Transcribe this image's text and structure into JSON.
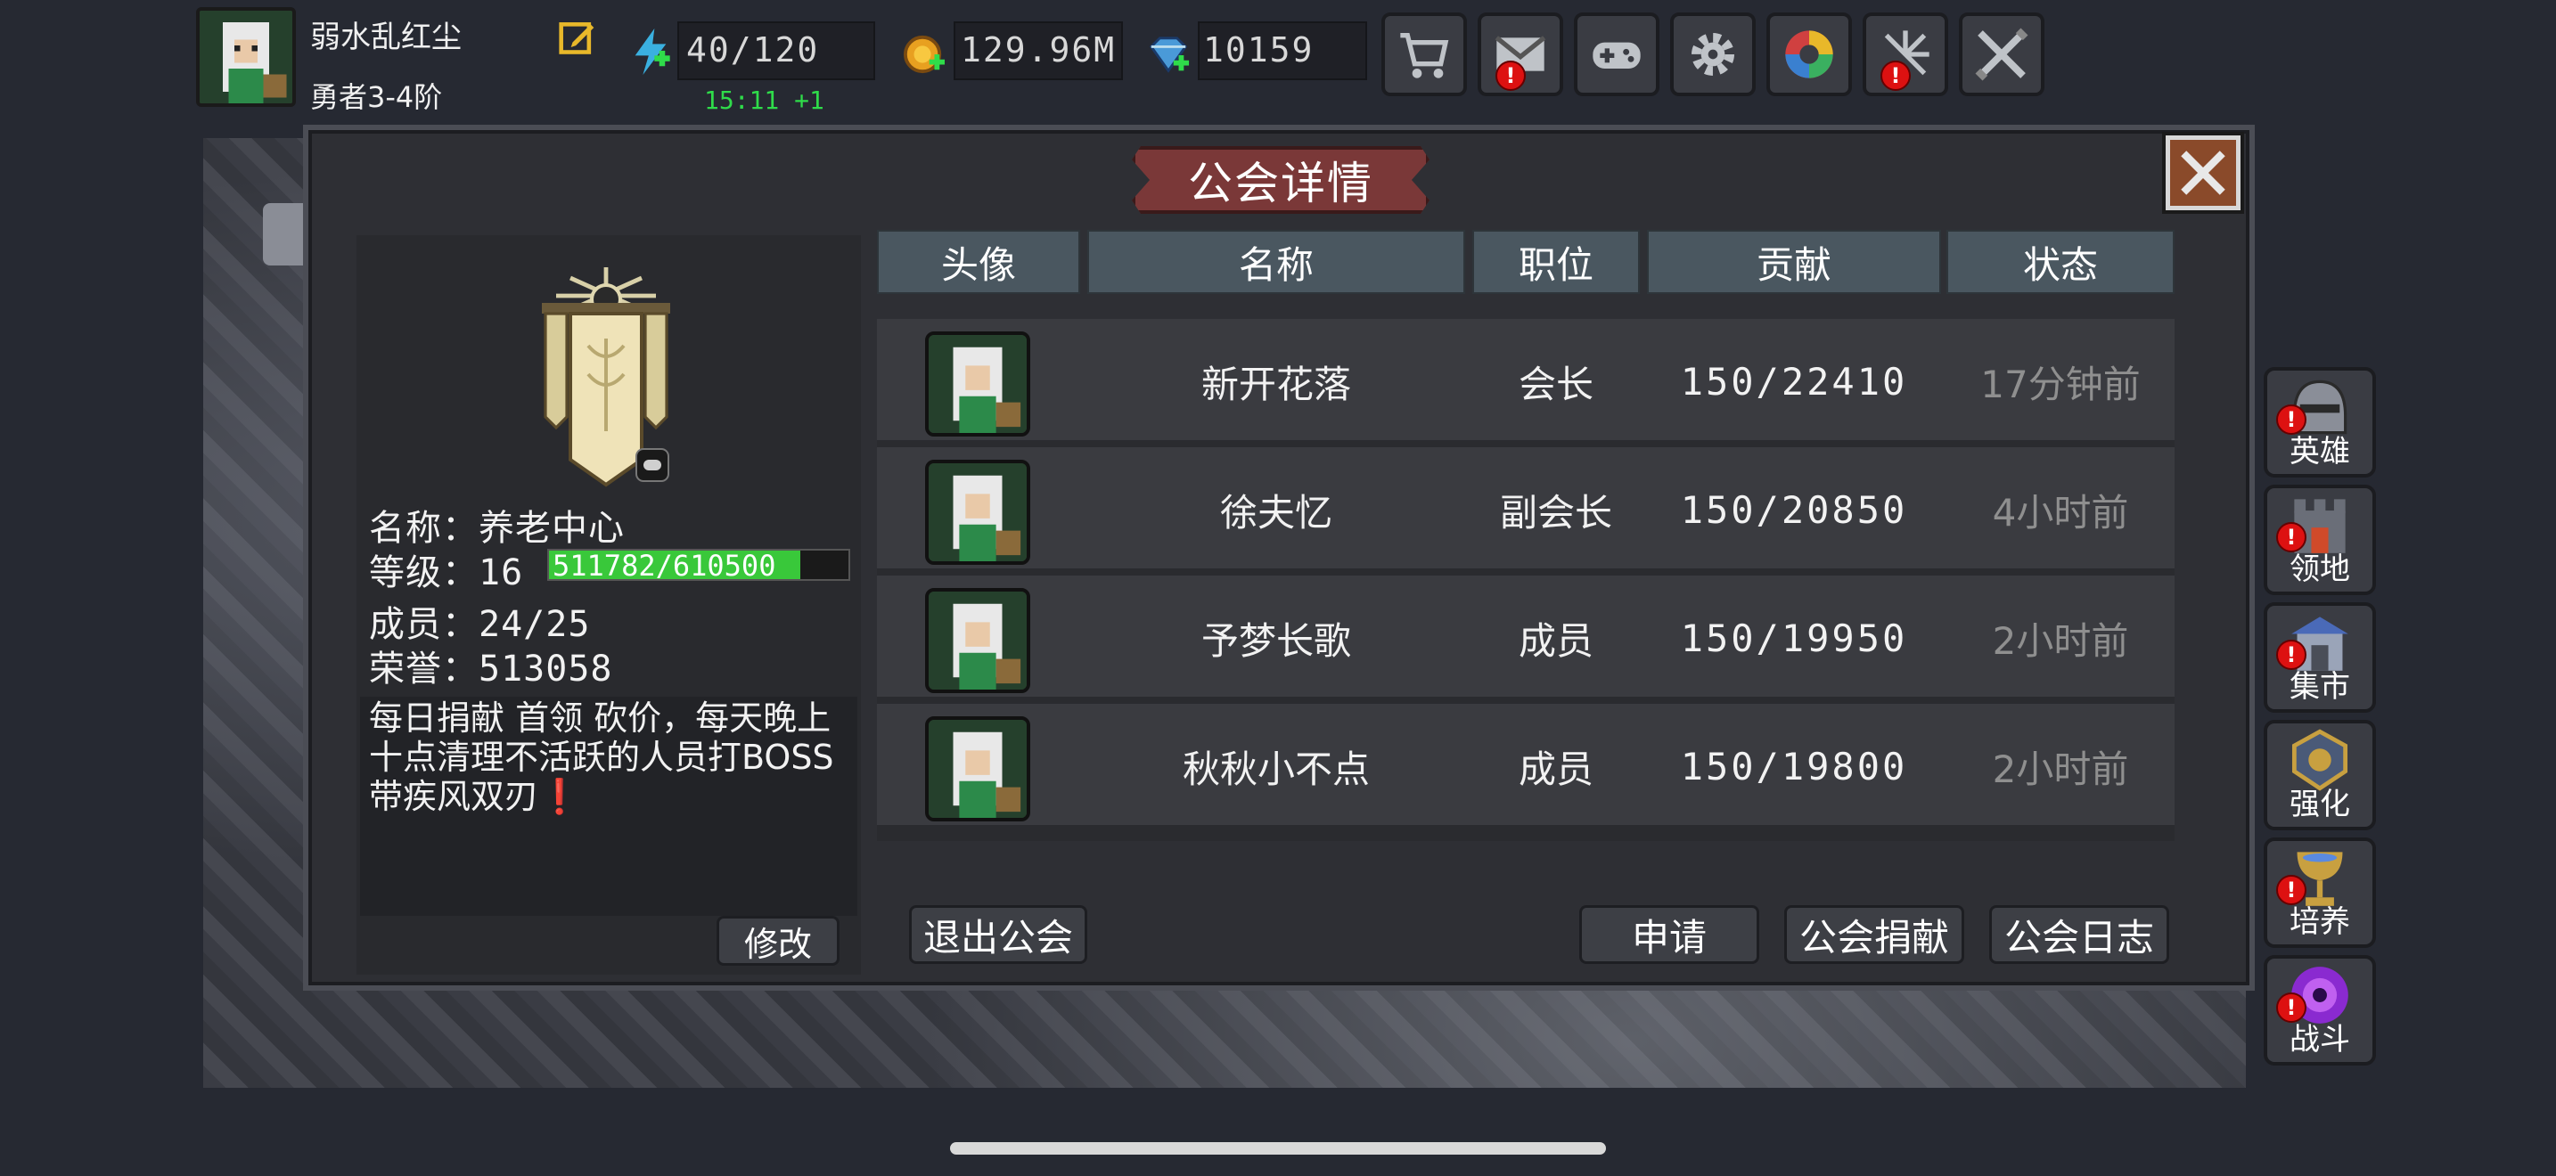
{
  "player": {
    "name": "弱水乱红尘",
    "rank": "勇者3-4阶"
  },
  "resources": {
    "energy": "40/120",
    "energy_timer": "15:11 +1",
    "gold": "129.96M",
    "gems": "10159"
  },
  "top_buttons": [
    {
      "icon": "cart-icon",
      "alert": false
    },
    {
      "icon": "mail-icon",
      "alert": true
    },
    {
      "icon": "gamepad-icon",
      "alert": false
    },
    {
      "icon": "gear-icon",
      "alert": false
    },
    {
      "icon": "aperture-icon",
      "alert": false
    },
    {
      "icon": "burst-icon",
      "alert": true
    },
    {
      "icon": "crossed-swords-icon",
      "alert": false
    }
  ],
  "dialog": {
    "title": "公会详情"
  },
  "guild": {
    "name_label": "名称：",
    "name": "养老中心",
    "level_label": "等级：",
    "level": "16",
    "xp_text": "511782/610500",
    "xp_fraction": 0.838,
    "members_label": "成员：",
    "members": "24/25",
    "honor_label": "荣誉：",
    "honor": "513058",
    "notice": "每日捐献 首领 砍价，每天晚上十点清理不活跃的人员打BOSS带疾风双刃❗",
    "edit_label": "修改"
  },
  "table": {
    "headers": [
      "头像",
      "名称",
      "职位",
      "贡献",
      "状态"
    ],
    "rows": [
      {
        "name": "新开花落",
        "position": "会长",
        "contribution": "150/22410",
        "status": "17分钟前"
      },
      {
        "name": "徐夫忆",
        "position": "副会长",
        "contribution": "150/20850",
        "status": "4小时前"
      },
      {
        "name": "予梦长歌",
        "position": "成员",
        "contribution": "150/19950",
        "status": "2小时前"
      },
      {
        "name": "秋秋小不点",
        "position": "成员",
        "contribution": "150/19800",
        "status": "2小时前"
      }
    ]
  },
  "actions": {
    "leave": "退出公会",
    "apply": "申请",
    "donate": "公会捐献",
    "log": "公会日志"
  },
  "side_nav": [
    {
      "label": "英雄",
      "icon": "helmet-icon",
      "alert": true
    },
    {
      "label": "领地",
      "icon": "castle-icon",
      "alert": true
    },
    {
      "label": "集市",
      "icon": "shop-icon",
      "alert": true
    },
    {
      "label": "强化",
      "icon": "emblem-icon",
      "alert": false
    },
    {
      "label": "培养",
      "icon": "chalice-icon",
      "alert": true
    },
    {
      "label": "战斗",
      "icon": "portal-icon",
      "alert": true
    }
  ],
  "colors": {
    "xp_fill": "#39c83a",
    "timer": "#2fdc4a",
    "alert": "#dd1111",
    "title_ribbon": "#7a3838",
    "table_header": "#4a5760"
  }
}
